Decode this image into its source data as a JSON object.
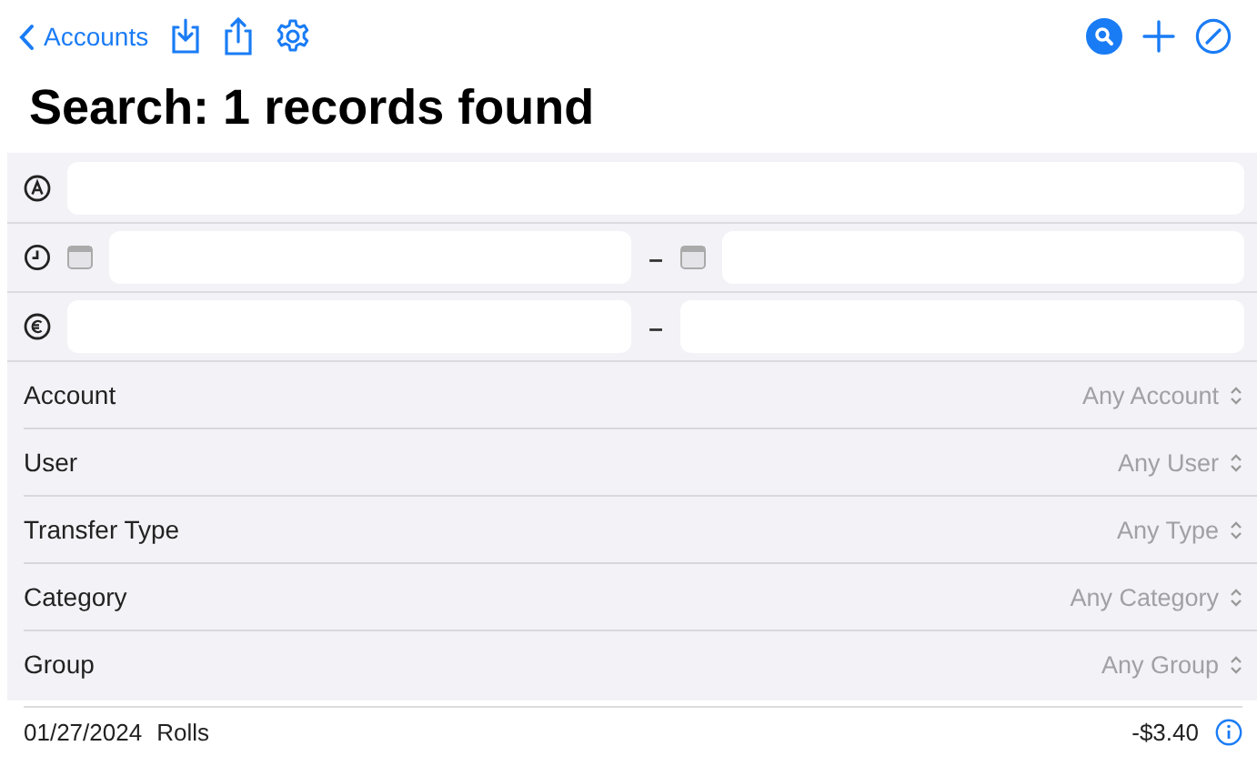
{
  "nav": {
    "back_label": "Accounts",
    "search_active": true
  },
  "title": "Search: 1 records found",
  "date_separator": "–",
  "amount_separator": "–",
  "pickers": [
    {
      "label": "Account",
      "value": "Any Account"
    },
    {
      "label": "User",
      "value": "Any User"
    },
    {
      "label": "Transfer Type",
      "value": "Any Type"
    },
    {
      "label": "Category",
      "value": "Any Category"
    },
    {
      "label": "Group",
      "value": "Any Group"
    }
  ],
  "results": [
    {
      "date": "01/27/2024",
      "name": "Rolls",
      "amount": "-$3.40"
    }
  ]
}
